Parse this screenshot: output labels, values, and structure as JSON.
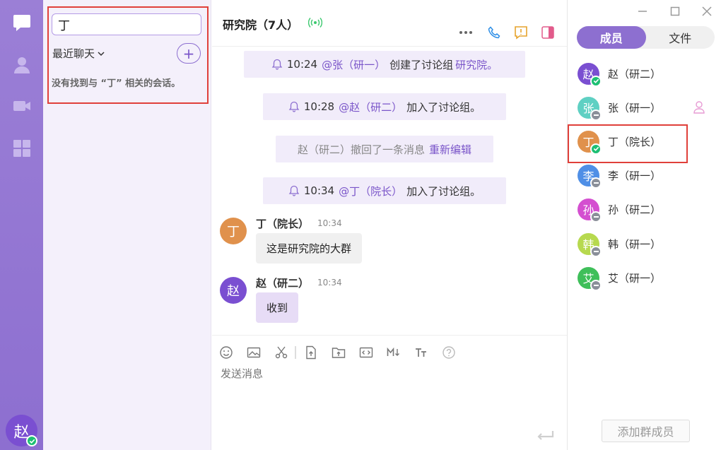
{
  "search": {
    "value": "丁",
    "placeholder": ""
  },
  "conversation_list": {
    "recent_label": "最近聊天",
    "add_label": "+",
    "empty_text": "没有找到与 “丁” 相关的会话。"
  },
  "chat": {
    "title": "研究院（7人）",
    "system_messages": [
      {
        "time": "10:24",
        "actor": "@张（研一）",
        "action": "创建了讨论组",
        "target": "研究院。"
      },
      {
        "time": "10:28",
        "actor": "@赵（研二）",
        "action": "加入了讨论组。",
        "target": ""
      },
      {
        "text": "赵（研二）撤回了一条消息",
        "link": "重新编辑"
      },
      {
        "time": "10:34",
        "actor": "@丁（院长）",
        "action": "加入了讨论组。",
        "target": ""
      }
    ],
    "messages": [
      {
        "avatar": "丁",
        "name": "丁（院长）",
        "time": "10:34",
        "text": "这是研究院的大群"
      },
      {
        "avatar": "赵",
        "name": "赵（研二）",
        "time": "10:34",
        "text": "收到"
      }
    ],
    "composer_placeholder": "发送消息"
  },
  "members_panel": {
    "tabs": [
      "成员",
      "文件"
    ],
    "members": [
      {
        "avatar": "赵",
        "name": "赵（研二）",
        "color": "#7a4fd1",
        "status": "online"
      },
      {
        "avatar": "张",
        "name": "张（研一）",
        "color": "#5fd0c3",
        "status": "away"
      },
      {
        "avatar": "丁",
        "name": "丁（院长）",
        "color": "#e0914c",
        "status": "online"
      },
      {
        "avatar": "李",
        "name": "李（研一）",
        "color": "#4f8fe6",
        "status": "away"
      },
      {
        "avatar": "孙",
        "name": "孙（研二）",
        "color": "#d44fd0",
        "status": "away"
      },
      {
        "avatar": "韩",
        "name": "韩（研一）",
        "color": "#b7d94f",
        "status": "away"
      },
      {
        "avatar": "艾",
        "name": "艾（研一）",
        "color": "#3fbf5a",
        "status": "away"
      }
    ],
    "add_button": "添加群成员"
  },
  "user": {
    "avatar": "赵"
  },
  "colors": {
    "accent": "#8d6fd0",
    "highlight": "#e0403a",
    "online": "#1dbf73"
  }
}
